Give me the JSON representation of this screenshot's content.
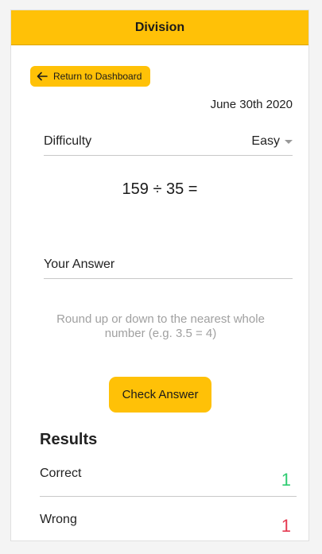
{
  "header": {
    "title": "Division"
  },
  "nav": {
    "back_label": "Return to Dashboard"
  },
  "date": "June 30th 2020",
  "difficulty": {
    "label": "Difficulty",
    "selected": "Easy"
  },
  "problem": {
    "text": "159 ÷ 35 ="
  },
  "answer": {
    "label": "Your Answer"
  },
  "hint": "Round up or down to the nearest whole number (e.g. 3.5 = 4)",
  "check_button": "Check Answer",
  "results": {
    "title": "Results",
    "correct_label": "Correct",
    "correct_value": "1",
    "wrong_label": "Wrong",
    "wrong_value": "1"
  },
  "colors": {
    "accent": "#ffc107",
    "correct": "#2ecc71",
    "wrong": "#e53950"
  }
}
